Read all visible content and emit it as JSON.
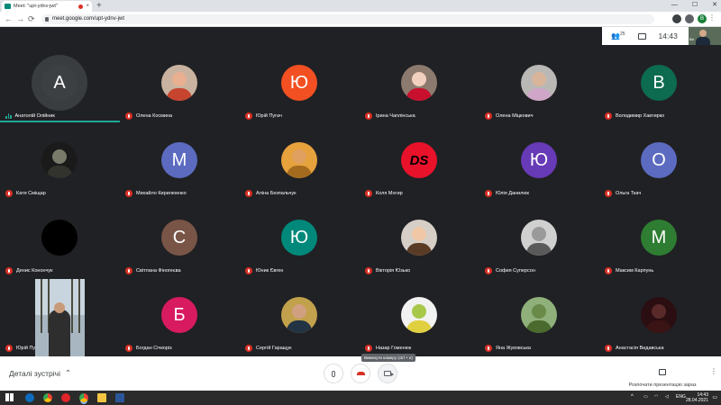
{
  "browser": {
    "tab_title": "Meet: \"upt-ydnv-jwt\"",
    "tab_close": "×",
    "new_tab": "+",
    "url": "meet.google.com/upt-ydnv-jwt",
    "nav_back": "←",
    "nav_forward": "→",
    "nav_reload": "⟳",
    "win_minimize": "—",
    "win_restore": "☐",
    "win_close": "✕",
    "menu": "⋮",
    "profile_initial": "B"
  },
  "meet_top": {
    "participants_count": "25",
    "clock": "14:43",
    "self_label": "Ви"
  },
  "participants": [
    {
      "name": "Анатолій Олійник",
      "initial": "А",
      "color": "#3c4043",
      "speaking": true
    },
    {
      "name": "Олена Космина",
      "photo": true,
      "c1": "#e8b090",
      "c2": "#c7442e",
      "bg": "#c9b3a0"
    },
    {
      "name": "Юрій Пугач",
      "initial": "Ю",
      "color": "#f25022"
    },
    {
      "name": "Ірина Чаплінська",
      "photo": true,
      "c1": "#f2d0c0",
      "c2": "#c8102e",
      "bg": "#8c7a6e"
    },
    {
      "name": "Олена Міцкович",
      "photo": true,
      "c1": "#d8b59a",
      "c2": "#cfa6c8",
      "bg": "#b9b8b5"
    },
    {
      "name": "Володимир Хавтирко",
      "initial": "В",
      "color": "#0d6b4f"
    },
    {
      "name": "Катя Сміщар",
      "photo": true,
      "c1": "#7a7a6a",
      "c2": "#33332e",
      "bg": "#1a1a1a"
    },
    {
      "name": "Михайло Кирилюенко",
      "initial": "М",
      "color": "#5c6bc0"
    },
    {
      "name": "Аліна Безпальчук",
      "photo": true,
      "c1": "#e0a060",
      "c2": "#a46b1f",
      "bg": "#e6a23c"
    },
    {
      "name": "Коля Могир",
      "ds": true,
      "text": "DS"
    },
    {
      "name": "Юлія Данилюк",
      "initial": "Ю",
      "color": "#673ab7"
    },
    {
      "name": "Ольга Ткач",
      "initial": "О",
      "color": "#5c6bc0"
    },
    {
      "name": "Денис Конончук",
      "photo": true,
      "c1": "#000000",
      "c2": "#000000",
      "bg": "#000000"
    },
    {
      "name": "Світлана Фіногеєва",
      "initial": "С",
      "color": "#795548"
    },
    {
      "name": "Юник Євген",
      "initial": "Ю",
      "color": "#00897b"
    },
    {
      "name": "Вікторія Юзько",
      "photo": true,
      "c1": "#f0c8a8",
      "c2": "#5a3b25",
      "bg": "#d6cfc7"
    },
    {
      "name": "София Суперсон",
      "photo": true,
      "c1": "#9a9a9a",
      "c2": "#5a5a5a",
      "bg": "#d0d0d0"
    },
    {
      "name": "Максим Карпунь",
      "initial": "М",
      "color": "#2e7d32"
    },
    {
      "name": "Юрій Пугач",
      "video": true
    },
    {
      "name": "Богдан Січкоріз",
      "initial": "Б",
      "color": "#d81b60"
    },
    {
      "name": "Сергій Гаращук",
      "photo": true,
      "c1": "#d0a080",
      "c2": "#223344",
      "bg": "#c2a14c"
    },
    {
      "name": "Назар Гоменюк",
      "photo": true,
      "c1": "#a8c84a",
      "c2": "#e0d040",
      "bg": "#f2f2f2"
    },
    {
      "name": "Яна Жуковська",
      "photo": true,
      "c1": "#6a8a4a",
      "c2": "#4a6a2e",
      "bg": "#8fb07a"
    },
    {
      "name": "Анастасія Видавська",
      "photo": true,
      "c1": "#5a2a2a",
      "c2": "#3a1414",
      "bg": "#2a0e12"
    }
  ],
  "bottom": {
    "details_label": "Деталі зустрічі",
    "chevron": "⌃",
    "tooltip": "Вимкнути камеру (ctrl + e)",
    "present_label": "Розпочати презентацію зараз",
    "kebab": "⋮"
  },
  "taskbar": {
    "lang": "ENG",
    "time": "14:43",
    "date": "28.04.2021",
    "tray_up": "^",
    "tray_notify": "▭"
  },
  "colors": {
    "meet_bg": "#202124",
    "speaking": "#1ea896",
    "mic_muted": "#d93025"
  }
}
